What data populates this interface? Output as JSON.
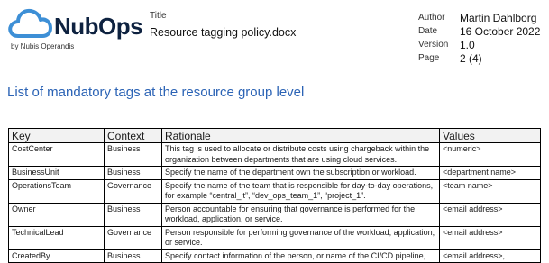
{
  "header": {
    "logo": {
      "name": "NubOps",
      "tagline": "by Nubis Operandis"
    },
    "title_label": "Title",
    "title_value": "Resource tagging policy.docx",
    "meta": [
      {
        "key": "Author",
        "value": "Martin Dahlborg"
      },
      {
        "key": "Date",
        "value": "16 October 2022"
      },
      {
        "key": "Version",
        "value": "1.0"
      },
      {
        "key": "Page",
        "value": "2 (4)"
      }
    ]
  },
  "section": {
    "heading": "List of mandatory tags at the resource group level"
  },
  "table": {
    "headers": [
      "Key",
      "Context",
      "Rationale",
      "Values"
    ],
    "rows": [
      {
        "key": "CostCenter",
        "context": "Business",
        "rationale": "This tag is used to allocate or distribute costs using chargeback within the organization between departments that are using cloud services.",
        "values": "<numeric>"
      },
      {
        "key": "BusinessUnit",
        "context": "Business",
        "rationale": "Specify the name of the department own the subscription or workload.",
        "values": "<department name>"
      },
      {
        "key": "OperationsTeam",
        "context": "Governance",
        "rationale": "Specify the name of the team that is responsible for day-to-day operations, for example “central_it”, “dev_ops_team_1”, “project_1”.",
        "values": "<team name>"
      },
      {
        "key": "Owner",
        "context": "Business",
        "rationale": "Person accountable for ensuring that governance is performed for the workload, application, or service.",
        "values": "<email address>"
      },
      {
        "key": "TechnicalLead",
        "context": "Governance",
        "rationale": "Person responsible for performing governance of the workload, application, or service.",
        "values": "<email address>"
      },
      {
        "key": "CreatedBy",
        "context": "Business",
        "rationale": "Specify contact information of the person, or name of the CI/CD pipeline,",
        "values": "<email address>,"
      }
    ]
  },
  "colors": {
    "brand_navy": "#0e2240",
    "cloud_blue": "#3d8fd6",
    "heading_blue": "#2b63b5"
  }
}
